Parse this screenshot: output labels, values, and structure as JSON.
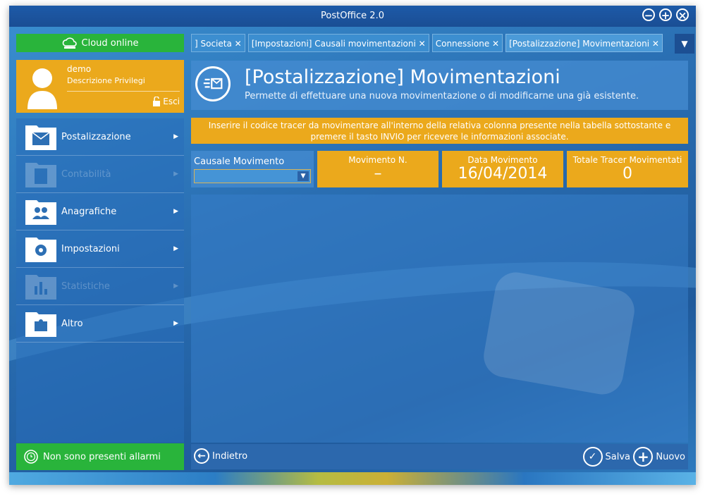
{
  "window": {
    "title": "PostOffice 2.0",
    "controls": [
      "minimize-icon",
      "maximize-icon",
      "close-icon"
    ]
  },
  "cloud": {
    "label": "Cloud online",
    "icon": "cloud-icon"
  },
  "user": {
    "name": "demo",
    "privileges": "Descrizione Privilegi",
    "logout_label": "Esci"
  },
  "sidebar": {
    "items": [
      {
        "label": "Postalizzazione",
        "icon": "envelope-folder-icon",
        "enabled": true
      },
      {
        "label": "Contabilità",
        "icon": "calculator-folder-icon",
        "enabled": false
      },
      {
        "label": "Anagrafiche",
        "icon": "people-folder-icon",
        "enabled": true
      },
      {
        "label": "Impostazioni",
        "icon": "gear-folder-icon",
        "enabled": true
      },
      {
        "label": "Statistiche",
        "icon": "bar-chart-folder-icon",
        "enabled": false
      },
      {
        "label": "Altro",
        "icon": "puzzle-folder-icon",
        "enabled": true
      }
    ]
  },
  "alarm": {
    "label": "Non sono presenti allarmi",
    "icon": "alarm-clock-icon"
  },
  "tabs": [
    {
      "label": "] Societa ✕"
    },
    {
      "label": "[Impostazioni] Causali movimentazioni ✕"
    },
    {
      "label": "Connessione ✕"
    },
    {
      "label": "[Postalizzazione] Movimentazioni ✕"
    }
  ],
  "header": {
    "title": "[Postalizzazione] Movimentazioni",
    "subtitle": "Permette di effettuare una nuova movimentazione o di modificarne una già esistente."
  },
  "notice": {
    "line1": "Inserire il codice tracer da movimentare all'interno della relativa colonna presente nella tabella sottostante e",
    "line2": "premere il tasto INVIO per ricevere le informazioni associate."
  },
  "causale": {
    "label": "Causale Movimento",
    "value": ""
  },
  "stats": {
    "movimento_label": "Movimento N.",
    "movimento_value": "–",
    "data_label": "Data Movimento",
    "data_value": "16/04/2014",
    "totale_label": "Totale Tracer Movimentati",
    "totale_value": "0"
  },
  "bottom": {
    "back_label": "Indietro",
    "save_label": "Salva",
    "new_label": "Nuovo"
  }
}
